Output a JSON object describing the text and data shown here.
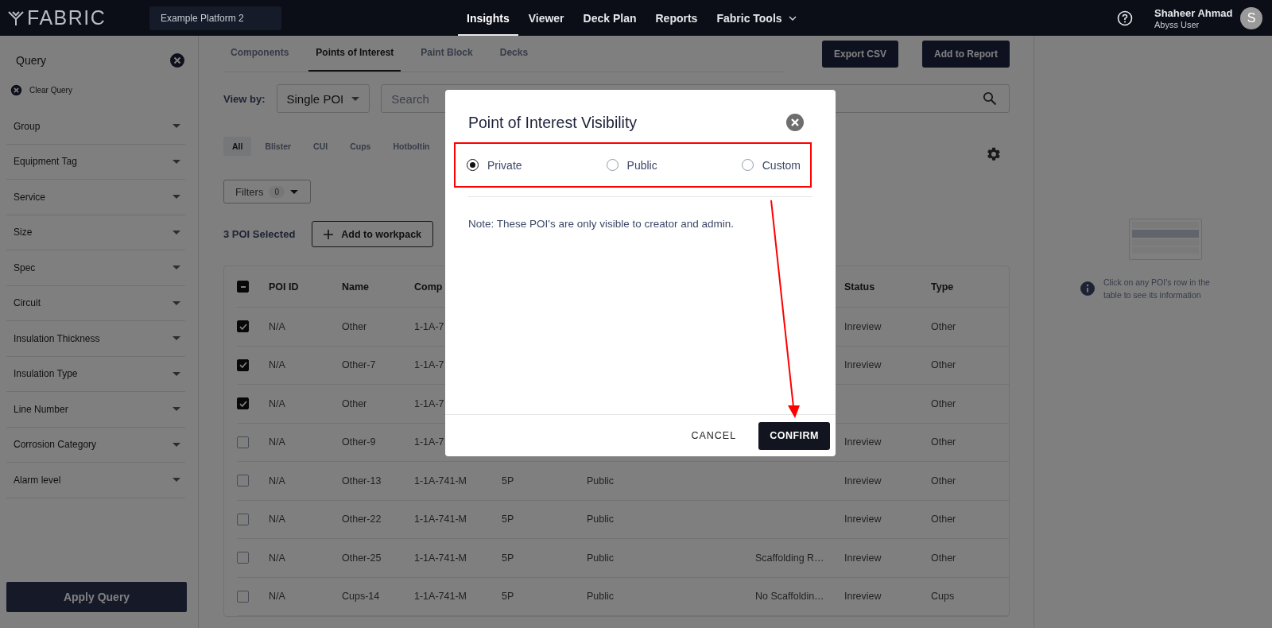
{
  "navbar": {
    "logo": "FABRIC",
    "platform": "Example Platform 2",
    "items": [
      {
        "label": "Insights",
        "selected": true,
        "dropdown": false
      },
      {
        "label": "Viewer",
        "selected": false,
        "dropdown": false
      },
      {
        "label": "Deck Plan",
        "selected": false,
        "dropdown": false
      },
      {
        "label": "Reports",
        "selected": false,
        "dropdown": false
      },
      {
        "label": "Fabric Tools",
        "selected": false,
        "dropdown": true
      }
    ],
    "user": {
      "name": "Shaheer Ahmad",
      "role": "Abyss User",
      "initial": "S"
    }
  },
  "query_panel": {
    "title": "Query",
    "clear": "Clear Query",
    "filters": [
      "Group",
      "Equipment Tag",
      "Service",
      "Size",
      "Spec",
      "Circuit",
      "Insulation Thickness",
      "Insulation Type",
      "Line Number",
      "Corrosion Category",
      "Alarm level"
    ],
    "apply": "Apply Query"
  },
  "main": {
    "tabs": [
      {
        "label": "Components",
        "selected": false
      },
      {
        "label": "Points of Interest",
        "selected": true
      },
      {
        "label": "Paint Block",
        "selected": false
      },
      {
        "label": "Decks",
        "selected": false
      }
    ],
    "buttons": [
      "Export CSV",
      "Add to Report"
    ],
    "view_by": {
      "label": "View by:",
      "value": "Single POI"
    },
    "search": {
      "placeholder": "Search"
    },
    "categories": [
      {
        "label": "All",
        "selected": true
      },
      {
        "label": "Blister",
        "selected": false
      },
      {
        "label": "CUI",
        "selected": false
      },
      {
        "label": "Cups",
        "selected": false
      },
      {
        "label": "Hotboltin",
        "selected": false
      }
    ],
    "filters": {
      "label": "Filters",
      "count": "0"
    },
    "selection": "3 POI Selected",
    "add_to_workpack": "Add to workpack",
    "table": {
      "select_all": {
        "indeterminate": true
      },
      "header": {
        "poi_id": "POI ID",
        "name": "Name",
        "component": "Comp",
        "status": "Status",
        "type": "Type"
      },
      "rows": [
        {
          "checked": true,
          "poi_id": "N/A",
          "name": "Other",
          "component": "1-1A-7",
          "status": "Inreview",
          "type": "Other"
        },
        {
          "checked": true,
          "poi_id": "N/A",
          "name": "Other-7",
          "component": "1-1A-7",
          "status": "Inreview",
          "type": "Other"
        },
        {
          "checked": true,
          "poi_id": "N/A",
          "name": "Other",
          "component": "1-1A-7",
          "type": "Other"
        },
        {
          "checked": false,
          "poi_id": "N/A",
          "name": "Other-9",
          "component": "1-1A-7",
          "status": "Inreview",
          "type": "Other"
        },
        {
          "checked": false,
          "poi_id": "N/A",
          "name": "Other-13",
          "component": "1-1A-741-M",
          "column_4": "5P",
          "column_5": "Public",
          "status": "Inreview",
          "type": "Other"
        },
        {
          "checked": false,
          "poi_id": "N/A",
          "name": "Other-22",
          "component": "1-1A-741-M",
          "column_4": "5P",
          "column_5": "Public",
          "status": "Inreview",
          "type": "Other"
        },
        {
          "checked": false,
          "poi_id": "N/A",
          "name": "Other-25",
          "component": "1-1A-741-M",
          "column_4": "5P",
          "column_5": "Public",
          "column_6": "Scaffolding R…",
          "status": "Inreview",
          "type": "Other"
        },
        {
          "checked": false,
          "poi_id": "N/A",
          "name": "Cups-14",
          "component": "1-1A-741-M",
          "column_4": "5P",
          "column_5": "Public",
          "column_6": "No Scaffoldin…",
          "status": "Inreview",
          "type": "Cups"
        }
      ]
    }
  },
  "details_panel": {
    "hint": "Click on any POI's row in the table to see its information"
  },
  "visibility_dialog": {
    "title": "Point of Interest Visibility",
    "options": [
      {
        "label": "Private",
        "selected": true
      },
      {
        "label": "Public",
        "selected": false
      },
      {
        "label": "Custom",
        "selected": false
      }
    ],
    "note": "Note: These POI's are only visible to creator and admin.",
    "buttons": [
      {
        "label": "CANCEL",
        "kind": "text"
      },
      {
        "label": "CONFIRM",
        "kind": "primary"
      }
    ]
  }
}
